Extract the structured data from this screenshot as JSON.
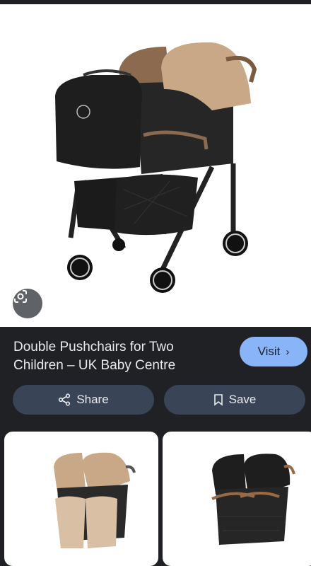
{
  "result": {
    "title": "Double Pushchairs for Two Children – UK Baby Centre",
    "visit_label": "Visit",
    "share_label": "Share",
    "save_label": "Save"
  },
  "icons": {
    "lens": "google-lens-icon",
    "share": "share-icon",
    "save": "bookmark-icon",
    "visit": "chevron-right-icon"
  },
  "colors": {
    "background": "#202124",
    "visit_button": "#8ab4f8",
    "action_button": "#394457",
    "canopy_beige": "#c9a887",
    "frame_black": "#1f1f1f"
  }
}
